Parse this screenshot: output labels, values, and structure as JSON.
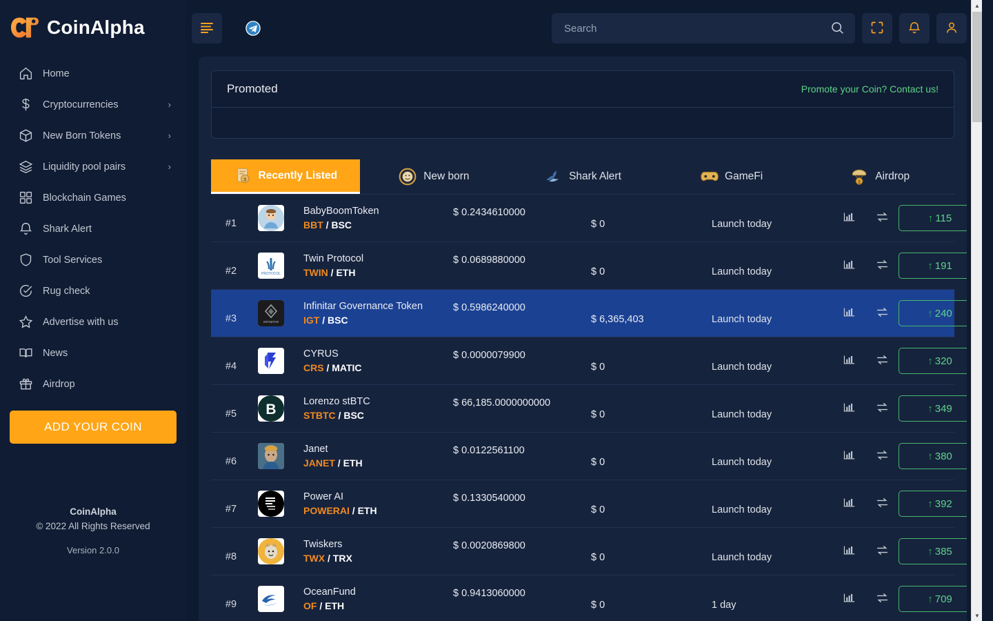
{
  "brand": {
    "name": "CoinAlpha"
  },
  "sidebar": {
    "items": [
      {
        "label": "Home",
        "icon": "home-icon",
        "chevron": ""
      },
      {
        "label": "Cryptocurrencies",
        "icon": "dollar-icon",
        "chevron": "›"
      },
      {
        "label": "New Born Tokens",
        "icon": "cube-icon",
        "chevron": "›"
      },
      {
        "label": "Liquidity pool pairs",
        "icon": "layers-icon",
        "chevron": "›"
      },
      {
        "label": "Blockchain Games",
        "icon": "grid-icon",
        "chevron": ""
      },
      {
        "label": "Shark Alert",
        "icon": "bell-icon",
        "chevron": ""
      },
      {
        "label": "Tool Services",
        "icon": "shield-icon",
        "chevron": ""
      },
      {
        "label": "Rug check",
        "icon": "check-circle-icon",
        "chevron": ""
      },
      {
        "label": "Advertise with us",
        "icon": "star-icon",
        "chevron": ""
      },
      {
        "label": "News",
        "icon": "book-icon",
        "chevron": ""
      },
      {
        "label": "Airdrop",
        "icon": "gift-icon",
        "chevron": ""
      }
    ],
    "add_coin_label": "ADD YOUR COIN",
    "footer": {
      "brand": "CoinAlpha",
      "copyright": "© 2022 All Rights Reserved",
      "version": "Version 2.0.0"
    }
  },
  "topbar": {
    "menu_icon": "hamburger-icon",
    "telegram_icon": "telegram-icon",
    "search_placeholder": "Search",
    "search_value": "",
    "fullscreen_icon": "fullscreen-icon",
    "notifications_icon": "bell-icon",
    "profile_icon": "user-icon"
  },
  "promoted": {
    "title": "Promoted",
    "link": "Promote your Coin? Contact us!"
  },
  "tabs": [
    {
      "label": "Recently Listed",
      "icon": "recently-listed-icon",
      "active": true
    },
    {
      "label": "New born",
      "icon": "new-born-icon",
      "active": false
    },
    {
      "label": "Shark Alert",
      "icon": "shark-alert-icon",
      "active": false
    },
    {
      "label": "GameFi",
      "icon": "gamefi-icon",
      "active": false
    },
    {
      "label": "Airdrop",
      "icon": "airdrop-icon",
      "active": false
    }
  ],
  "colors": {
    "accent": "#ffa516",
    "symbol": "#f08a20",
    "green": "#5fd38a",
    "selected_row": "#1b4193",
    "sidebar_bg": "#101c33",
    "panel_bg": "#16233d"
  },
  "table": {
    "rows": [
      {
        "rank": "#1",
        "name": "BabyBoomToken",
        "symbol": "BBT",
        "chain": "BSC",
        "price": "$ 0.2434610000",
        "marketcap": "$ 0",
        "launch": "Launch today",
        "votes": "115",
        "arrow": "↑",
        "selected": false,
        "logo_kind": "baby"
      },
      {
        "rank": "#2",
        "name": "Twin Protocol",
        "symbol": "TWIN",
        "chain": "ETH",
        "price": "$ 0.0689880000",
        "marketcap": "$ 0",
        "launch": "Launch today",
        "votes": "191",
        "arrow": "↑",
        "selected": false,
        "logo_kind": "twin"
      },
      {
        "rank": "#3",
        "name": "Infinitar Governance Token",
        "symbol": "IGT",
        "chain": "BSC",
        "price": "$ 0.5986240000",
        "marketcap": "$ 6,365,403",
        "launch": "Launch today",
        "votes": "240",
        "arrow": "↑",
        "selected": true,
        "logo_kind": "infinitar"
      },
      {
        "rank": "#4",
        "name": "CYRUS",
        "symbol": "CRS",
        "chain": "MATIC",
        "price": "$ 0.0000079900",
        "marketcap": "$ 0",
        "launch": "Launch today",
        "votes": "320",
        "arrow": "↑",
        "selected": false,
        "logo_kind": "cyrus"
      },
      {
        "rank": "#5",
        "name": "Lorenzo stBTC",
        "symbol": "STBTC",
        "chain": "BSC",
        "price": "$ 66,185.0000000000",
        "marketcap": "$ 0",
        "launch": "Launch today",
        "votes": "349",
        "arrow": "↑",
        "selected": false,
        "logo_kind": "btc"
      },
      {
        "rank": "#6",
        "name": "Janet",
        "symbol": "JANET",
        "chain": "ETH",
        "price": "$ 0.0122561100",
        "marketcap": "$ 0",
        "launch": "Launch today",
        "votes": "380",
        "arrow": "↑",
        "selected": false,
        "logo_kind": "janet"
      },
      {
        "rank": "#7",
        "name": "Power AI",
        "symbol": "POWERAI",
        "chain": "ETH",
        "price": "$ 0.1330540000",
        "marketcap": "$ 0",
        "launch": "Launch today",
        "votes": "392",
        "arrow": "↑",
        "selected": false,
        "logo_kind": "powerai"
      },
      {
        "rank": "#8",
        "name": "Twiskers",
        "symbol": "TWX",
        "chain": "TRX",
        "price": "$ 0.0020869800",
        "marketcap": "$ 0",
        "launch": "Launch today",
        "votes": "385",
        "arrow": "↑",
        "selected": false,
        "logo_kind": "twiskers"
      },
      {
        "rank": "#9",
        "name": "OceanFund",
        "symbol": "OF",
        "chain": "ETH",
        "price": "$ 0.9413060000",
        "marketcap": "$ 0",
        "launch": "1 day",
        "votes": "709",
        "arrow": "↑",
        "selected": false,
        "logo_kind": "ocean"
      }
    ],
    "row_icons": {
      "chart": "bar-chart-icon",
      "swap": "swap-icon"
    }
  }
}
